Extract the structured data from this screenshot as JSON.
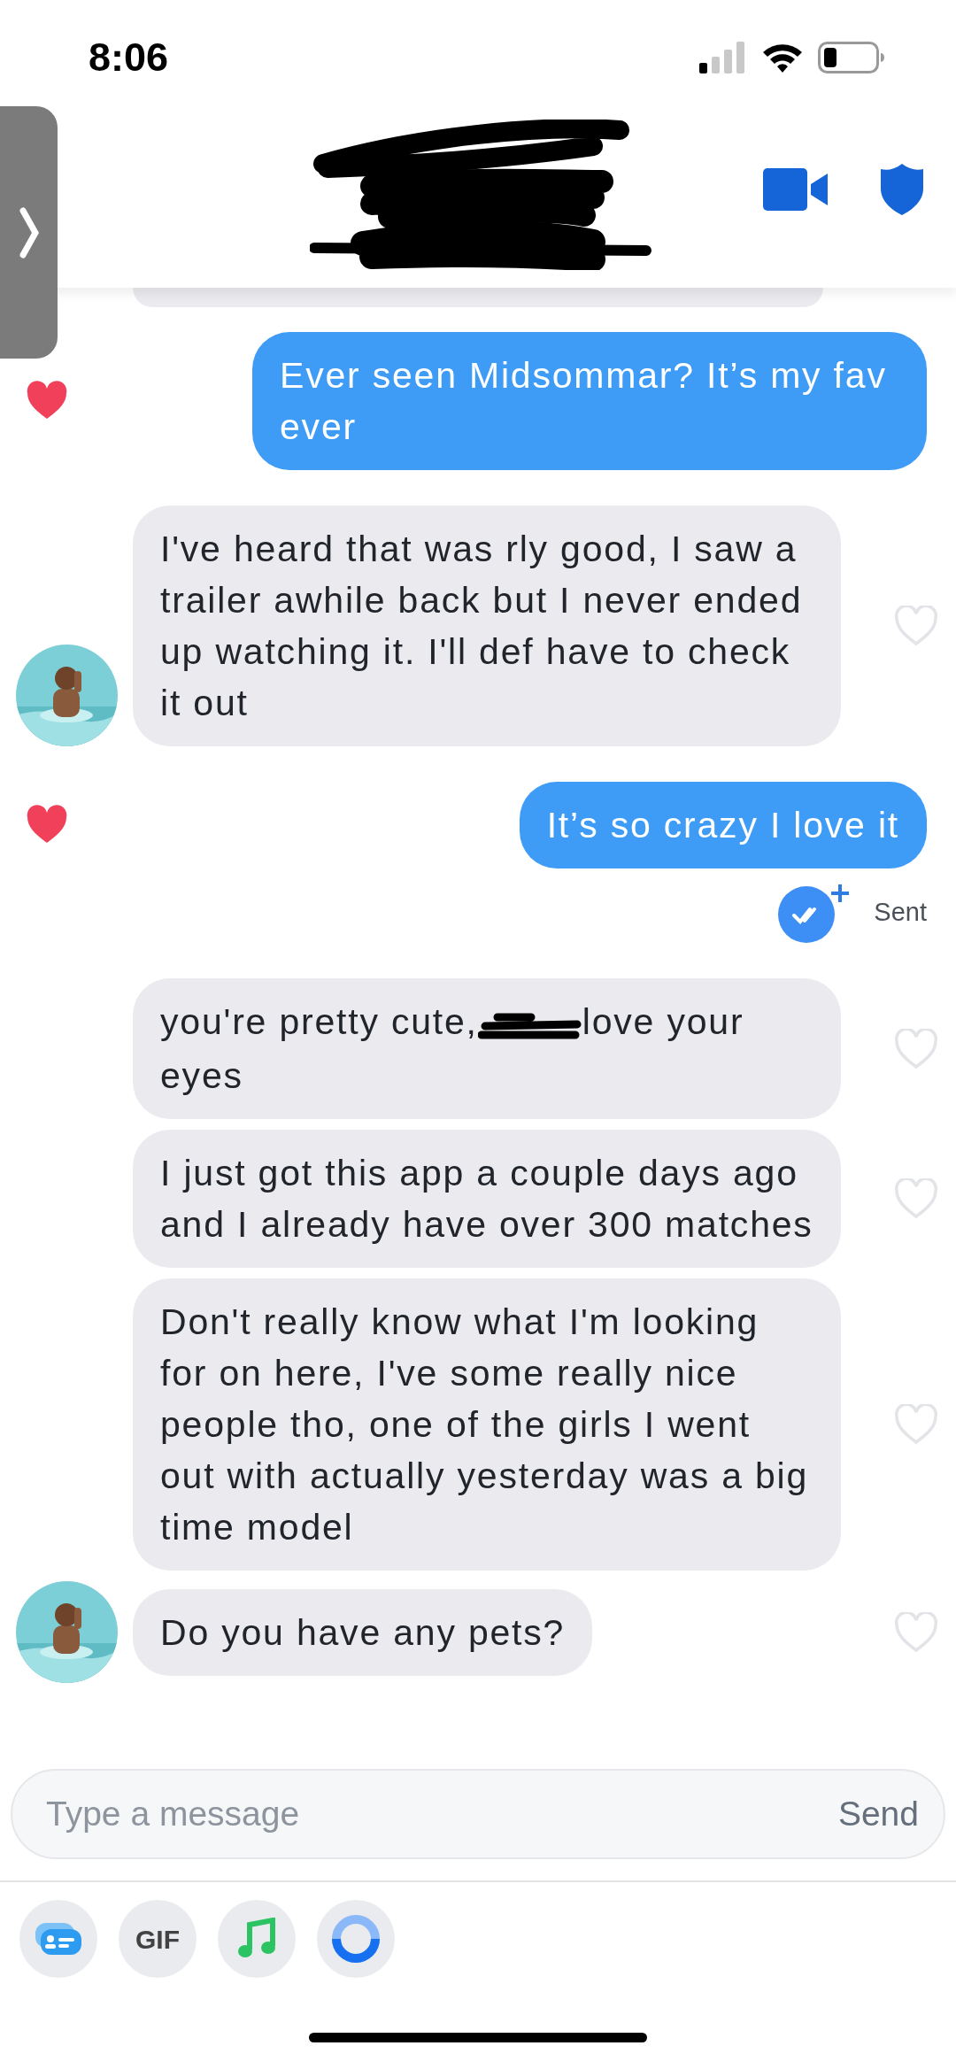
{
  "status_bar": {
    "time": "8:06"
  },
  "messages": [
    {
      "kind": "sent",
      "text": "Ever seen Midsommar? It’s my fav ever",
      "liked": true
    },
    {
      "kind": "received",
      "text": "I've heard that was rly good, I saw a trailer awhile back but I never ended up watching it. I'll def have to check it out",
      "liked": false,
      "avatar": true
    },
    {
      "kind": "sent",
      "text": "It’s so crazy I love it",
      "liked": true,
      "status": "Sent"
    },
    {
      "kind": "received_redacted",
      "text_before": "you're pretty cute,",
      "text_after": "love your eyes",
      "liked": false,
      "avatar": false
    },
    {
      "kind": "received",
      "text": "I just got this app a couple days ago and I already have over 300 matches",
      "liked": false,
      "avatar": false
    },
    {
      "kind": "received",
      "text": "Don't really know what I'm looking for on here, I've some really nice people tho, one of the girls I went out with actually yesterday was a big time model",
      "liked": false,
      "avatar": false
    },
    {
      "kind": "received",
      "text": "Do you have any pets?",
      "liked": false,
      "avatar": true
    }
  ],
  "composer": {
    "placeholder": "Type a message",
    "send_label": "Send"
  },
  "toolbar": [
    {
      "kind": "card"
    },
    {
      "kind": "gif",
      "label": "GIF"
    },
    {
      "kind": "music"
    },
    {
      "kind": "ring"
    }
  ]
}
